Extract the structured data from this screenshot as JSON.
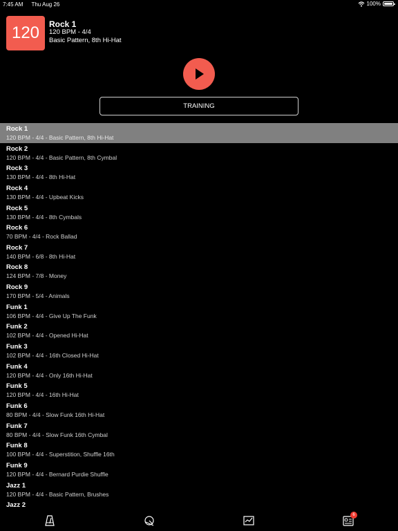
{
  "status": {
    "time": "7:45 AM",
    "date": "Thu Aug 26",
    "battery": "100%"
  },
  "header": {
    "bpm": "120",
    "title": "Rock 1",
    "meter_line": "120 BPM - 4/4",
    "pattern_line": "Basic Pattern, 8th Hi-Hat"
  },
  "controls": {
    "play_icon": "play-icon",
    "training_label": "TRAINING"
  },
  "list": [
    {
      "name": "Rock 1",
      "desc": "120 BPM - 4/4 - Basic Pattern, 8th Hi-Hat",
      "selected": true
    },
    {
      "name": "Rock 2",
      "desc": "120 BPM - 4/4 - Basic Pattern, 8th Cymbal"
    },
    {
      "name": "Rock 3",
      "desc": "130 BPM - 4/4 - 8th Hi-Hat"
    },
    {
      "name": "Rock 4",
      "desc": "130 BPM - 4/4 - Upbeat Kicks"
    },
    {
      "name": "Rock 5",
      "desc": "130 BPM - 4/4 - 8th Cymbals"
    },
    {
      "name": "Rock 6",
      "desc": "70 BPM - 4/4 - Rock Ballad"
    },
    {
      "name": "Rock 7",
      "desc": "140 BPM - 6/8 - 8th Hi-Hat"
    },
    {
      "name": "Rock 8",
      "desc": "124 BPM - 7/8 - Money"
    },
    {
      "name": "Rock 9",
      "desc": "170 BPM - 5/4 - Animals"
    },
    {
      "name": "Funk 1",
      "desc": "106 BPM - 4/4 - Give Up The Funk"
    },
    {
      "name": "Funk 2",
      "desc": "102 BPM - 4/4 - Opened Hi-Hat"
    },
    {
      "name": "Funk 3",
      "desc": "102 BPM - 4/4 - 16th Closed Hi-Hat"
    },
    {
      "name": "Funk 4",
      "desc": "120 BPM - 4/4 - Only 16th Hi-Hat"
    },
    {
      "name": "Funk 5",
      "desc": "120 BPM - 4/4 - 16th Hi-Hat"
    },
    {
      "name": "Funk 6",
      "desc": "80 BPM - 4/4 - Slow Funk 16th Hi-Hat"
    },
    {
      "name": "Funk 7",
      "desc": "80 BPM - 4/4 - Slow Funk 16th Cymbal"
    },
    {
      "name": "Funk 8",
      "desc": "100 BPM - 4/4 - Superstition, Shuffle 16th"
    },
    {
      "name": "Funk 9",
      "desc": "120 BPM - 4/4 - Bernard Purdie Shuffle"
    },
    {
      "name": "Jazz 1",
      "desc": "120 BPM - 4/4 - Basic Pattern, Brushes"
    },
    {
      "name": "Jazz 2",
      "desc": ""
    }
  ],
  "tabs": [
    {
      "icon": "metronome-icon"
    },
    {
      "icon": "drum-icon"
    },
    {
      "icon": "practice-chart-icon"
    },
    {
      "icon": "mixer-icon",
      "badge": "6"
    }
  ],
  "colors": {
    "accent": "#f25c4f",
    "selected_row": "#808080",
    "background": "#000000"
  }
}
